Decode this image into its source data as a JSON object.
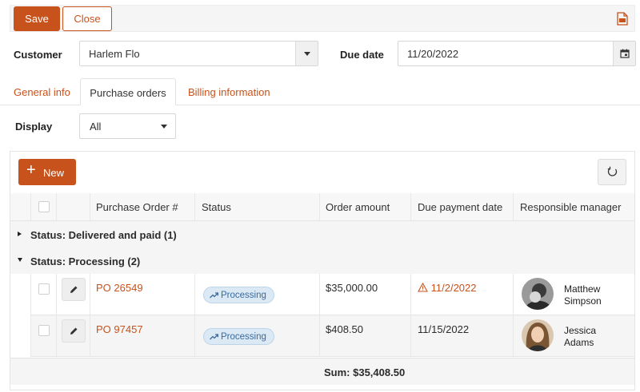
{
  "toolbar": {
    "save_label": "Save",
    "close_label": "Close",
    "export_icon": "pdf-export-icon"
  },
  "form": {
    "customer_label": "Customer",
    "customer_value": "Harlem Flo",
    "due_date_label": "Due date",
    "due_date_value": "11/20/2022"
  },
  "tabs": [
    {
      "label": "General info",
      "active": false
    },
    {
      "label": "Purchase orders",
      "active": true
    },
    {
      "label": "Billing information",
      "active": false
    }
  ],
  "display": {
    "label": "Display",
    "value": "All"
  },
  "grid": {
    "new_label": "New",
    "columns": [
      "Purchase Order #",
      "Status",
      "Order amount",
      "Due payment date",
      "Responsible manager"
    ],
    "groups": [
      {
        "label": "Status: Delivered and paid (1)",
        "expanded": false
      },
      {
        "label": "Status: Processing (2)",
        "expanded": true
      }
    ],
    "rows": [
      {
        "po": "PO 26549",
        "status": "Processing",
        "amount": "$35,000.00",
        "due": "11/2/2022",
        "overdue": true,
        "manager_first": "Matthew",
        "manager_last": "Simpson"
      },
      {
        "po": "PO 97457",
        "status": "Processing",
        "amount": "$408.50",
        "due": "11/15/2022",
        "overdue": false,
        "manager_first": "Jessica",
        "manager_last": "Adams"
      }
    ],
    "sum": "Sum: $35,408.50"
  },
  "colors": {
    "accent": "#c7521c",
    "badge_bg": "#dbe9f5",
    "badge_text": "#3d6a99"
  }
}
